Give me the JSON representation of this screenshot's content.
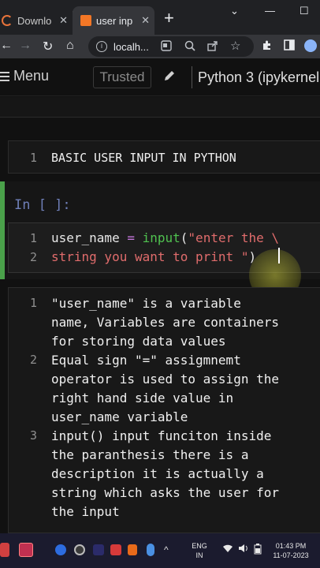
{
  "browser": {
    "tabs": [
      {
        "label": "Downlo",
        "active": false
      },
      {
        "label": "user inp",
        "active": true
      }
    ],
    "close_glyph": "✕",
    "new_tab_glyph": "+",
    "window_controls": {
      "chevron": "⌄",
      "minimize": "—",
      "maximize": "☐"
    },
    "address": "localh...",
    "nav": {
      "back": "←",
      "forward": "→",
      "reload": "↻",
      "home": "⌂"
    }
  },
  "jupyter": {
    "menu_label": "Menu",
    "trusted_label": "Trusted",
    "kernel_label": "Python 3 (ipykernel"
  },
  "cells": {
    "md1": {
      "line_number": "1",
      "text": "BASIC USER INPUT IN PYTHON"
    },
    "code": {
      "prompt": "In [ ]:",
      "line_numbers": [
        "1",
        "2"
      ],
      "line1": {
        "var": "user_name",
        "op": " = ",
        "fn": "input",
        "paren": "(",
        "str": "\"enter the \\"
      },
      "line2": {
        "str": "string you want to print \"",
        "paren": ")"
      }
    },
    "md2": {
      "line_numbers": [
        "1",
        "2",
        "3"
      ],
      "lines": [
        "\"user_name\" is a variable",
        "name, Variables are containers",
        "for storing data values",
        "Equal sign \"=\" assigmnemt",
        "operator is used to assign the",
        "right hand side value in",
        "user_name variable",
        "input() input funciton inside",
        "the paranthesis there is a",
        "description it is actually a",
        "string which asks the user for",
        "the input"
      ]
    }
  },
  "taskbar": {
    "language": "ENG",
    "region": "IN",
    "time": "01:43 PM",
    "date": "11-07-2023"
  },
  "colors": {
    "accent_green": "#4aa14a",
    "keyword_purple": "#c678dd",
    "function_green": "#4fc14f",
    "string_red": "#e06c6c"
  }
}
